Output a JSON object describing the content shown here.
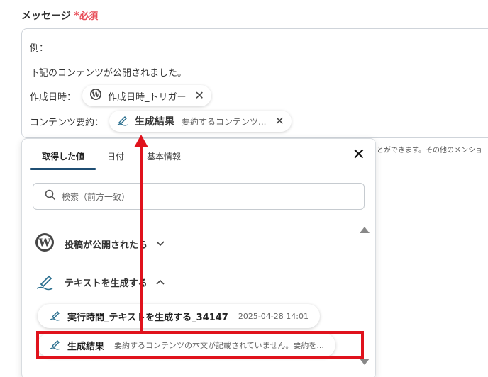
{
  "field": {
    "label": "メッセージ",
    "required_star": "*",
    "required_text": "必須"
  },
  "message": {
    "line_example": "例：",
    "line_body": "下記のコンテンツが公開されました。",
    "label_created": "作成日時：",
    "chip_created": "作成日時_トリガー",
    "label_summary": "コンテンツ要約：",
    "chip_summary_title": "生成結果",
    "chip_summary_sub": "要約するコンテンツ..."
  },
  "side_hint": "とができます。その他のメンショ",
  "panel": {
    "tabs": [
      "取得した値",
      "日付",
      "基本情報"
    ],
    "search_placeholder": "検索（前方一致）",
    "groups": [
      {
        "label": "投稿が公開されたら",
        "icon": "wordpress-icon",
        "state": "collapsed"
      },
      {
        "label": "テキストを生成する",
        "icon": "pen-icon",
        "state": "expanded"
      }
    ],
    "items": [
      {
        "label": "実行時間_テキストを生成する_34147",
        "sub": "2025-04-28 14:01"
      },
      {
        "label": "生成結果",
        "sub": "要約するコンテンツの本文が記載されていません。要約を..."
      }
    ]
  },
  "colors": {
    "required": "#e8505b",
    "annotation": "#e0121c",
    "tab_underline": "#1f4e73",
    "pen_icon": "#2a6f8f"
  }
}
